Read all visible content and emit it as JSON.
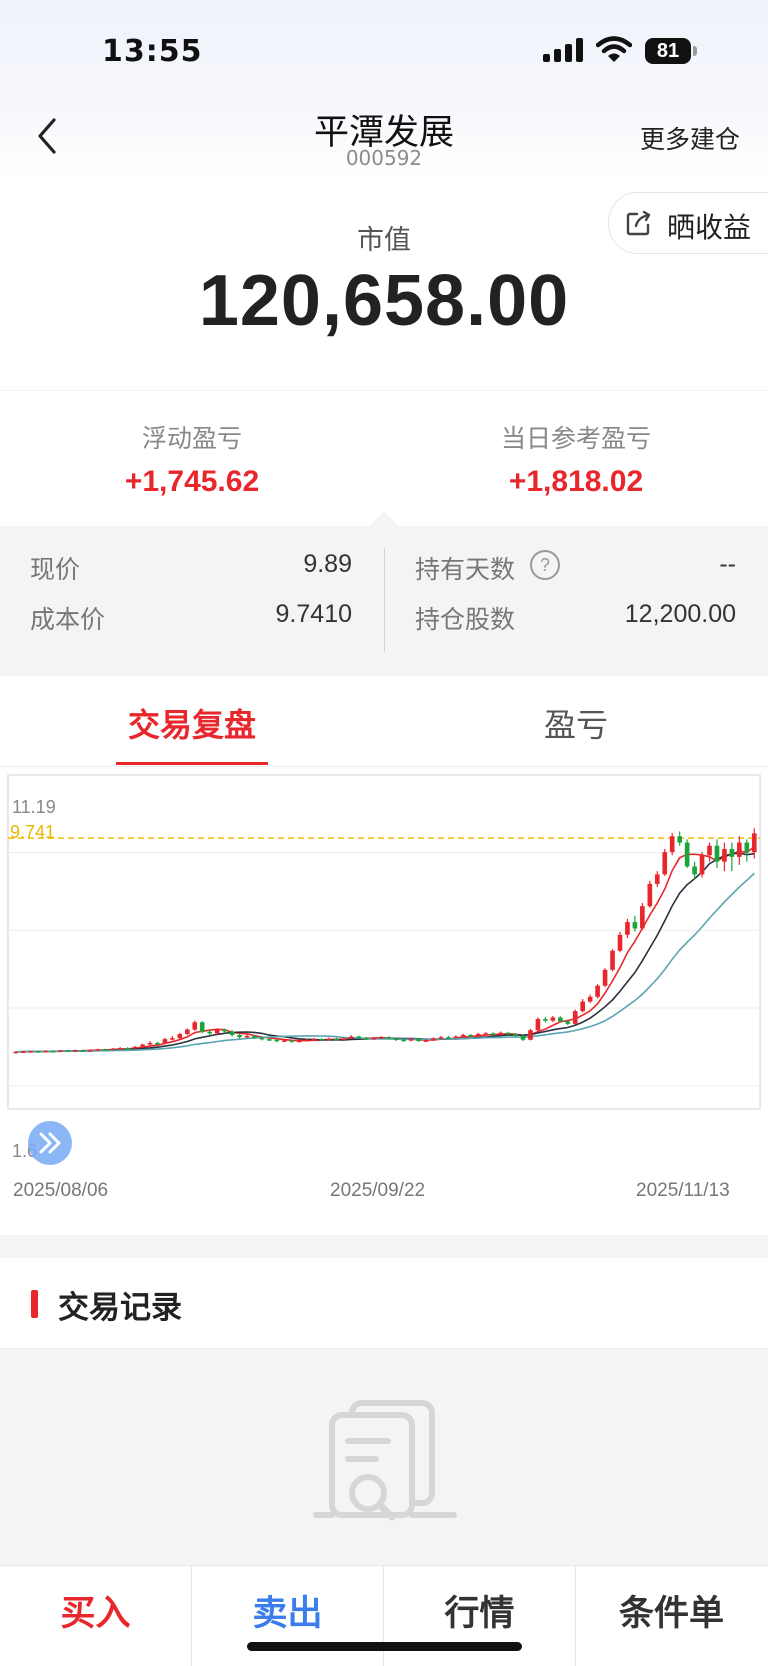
{
  "status_bar": {
    "time": "13:55",
    "battery": "81"
  },
  "nav": {
    "title": "平潭发展",
    "code": "000592",
    "more_label": "更多建仓"
  },
  "summary": {
    "share_label": "晒收益",
    "market_value_label": "市值",
    "market_value": "120,658.00"
  },
  "pnl": {
    "floating_label": "浮动盈亏",
    "floating_value": "+1,745.62",
    "daily_label": "当日参考盈亏",
    "daily_value": "+1,818.02"
  },
  "details": {
    "price_label": "现价",
    "price_value": "9.89",
    "cost_label": "成本价",
    "cost_value": "9.7410",
    "days_label": "持有天数",
    "days_value": "--",
    "shares_label": "持仓股数",
    "shares_value": "12,200.00",
    "help_glyph": "?"
  },
  "tabs": [
    {
      "label": "交易复盘",
      "active": true
    },
    {
      "label": "盈亏",
      "active": false
    }
  ],
  "chart": {
    "y_max_label": "11.19",
    "cost_label": "9.741",
    "y_min_label": "1.6",
    "x_labels": [
      "2025/08/06",
      "2025/09/22",
      "2025/11/13"
    ]
  },
  "chart_data": {
    "type": "candlestick",
    "ylim": [
      1.6,
      11.19
    ],
    "cost_line": 9.741,
    "x_ticks": [
      "2025/08/06",
      "2025/09/22",
      "2025/11/13"
    ],
    "up_color": "#e8272d",
    "down_color": "#1aa43a",
    "candles": [
      [
        3.0,
        3.02,
        3.04,
        2.98
      ],
      [
        3.02,
        3.03,
        3.05,
        3.0
      ],
      [
        3.03,
        3.04,
        3.06,
        3.01
      ],
      [
        3.04,
        3.03,
        3.06,
        3.01
      ],
      [
        3.03,
        3.05,
        3.07,
        3.02
      ],
      [
        3.05,
        3.04,
        3.07,
        3.02
      ],
      [
        3.04,
        3.06,
        3.08,
        3.03
      ],
      [
        3.06,
        3.05,
        3.08,
        3.03
      ],
      [
        3.05,
        3.07,
        3.09,
        3.04
      ],
      [
        3.07,
        3.06,
        3.09,
        3.04
      ],
      [
        3.06,
        3.08,
        3.1,
        3.05
      ],
      [
        3.08,
        3.1,
        3.12,
        3.06
      ],
      [
        3.1,
        3.09,
        3.12,
        3.07
      ],
      [
        3.09,
        3.12,
        3.14,
        3.08
      ],
      [
        3.12,
        3.14,
        3.17,
        3.1
      ],
      [
        3.14,
        3.13,
        3.16,
        3.11
      ],
      [
        3.13,
        3.18,
        3.2,
        3.12
      ],
      [
        3.18,
        3.25,
        3.28,
        3.15
      ],
      [
        3.25,
        3.3,
        3.36,
        3.22
      ],
      [
        3.3,
        3.28,
        3.34,
        3.24
      ],
      [
        3.28,
        3.42,
        3.46,
        3.26
      ],
      [
        3.42,
        3.45,
        3.52,
        3.38
      ],
      [
        3.45,
        3.58,
        3.62,
        3.42
      ],
      [
        3.58,
        3.72,
        3.76,
        3.54
      ],
      [
        3.72,
        3.95,
        4.0,
        3.68
      ],
      [
        3.95,
        3.65,
        3.98,
        3.6
      ],
      [
        3.65,
        3.6,
        3.7,
        3.55
      ],
      [
        3.6,
        3.72,
        3.76,
        3.56
      ],
      [
        3.72,
        3.66,
        3.75,
        3.6
      ],
      [
        3.66,
        3.55,
        3.7,
        3.5
      ],
      [
        3.55,
        3.48,
        3.58,
        3.44
      ],
      [
        3.48,
        3.52,
        3.56,
        3.45
      ],
      [
        3.52,
        3.46,
        3.55,
        3.42
      ],
      [
        3.46,
        3.42,
        3.5,
        3.38
      ],
      [
        3.42,
        3.4,
        3.46,
        3.36
      ],
      [
        3.4,
        3.36,
        3.44,
        3.32
      ],
      [
        3.36,
        3.38,
        3.42,
        3.33
      ],
      [
        3.38,
        3.35,
        3.41,
        3.31
      ],
      [
        3.35,
        3.37,
        3.4,
        3.32
      ],
      [
        3.37,
        3.4,
        3.44,
        3.34
      ],
      [
        3.4,
        3.42,
        3.46,
        3.37
      ],
      [
        3.42,
        3.4,
        3.45,
        3.37
      ],
      [
        3.4,
        3.43,
        3.47,
        3.38
      ],
      [
        3.43,
        3.41,
        3.46,
        3.38
      ],
      [
        3.41,
        3.44,
        3.48,
        3.39
      ],
      [
        3.44,
        3.5,
        3.54,
        3.42
      ],
      [
        3.5,
        3.46,
        3.53,
        3.43
      ],
      [
        3.46,
        3.42,
        3.49,
        3.39
      ],
      [
        3.42,
        3.45,
        3.49,
        3.4
      ],
      [
        3.45,
        3.48,
        3.52,
        3.43
      ],
      [
        3.48,
        3.44,
        3.51,
        3.41
      ],
      [
        3.44,
        3.4,
        3.47,
        3.36
      ],
      [
        3.4,
        3.38,
        3.43,
        3.34
      ],
      [
        3.38,
        3.42,
        3.46,
        3.35
      ],
      [
        3.42,
        3.36,
        3.45,
        3.33
      ],
      [
        3.36,
        3.38,
        3.42,
        3.33
      ],
      [
        3.38,
        3.44,
        3.48,
        3.36
      ],
      [
        3.44,
        3.48,
        3.52,
        3.41
      ],
      [
        3.48,
        3.46,
        3.52,
        3.43
      ],
      [
        3.46,
        3.5,
        3.54,
        3.44
      ],
      [
        3.5,
        3.55,
        3.59,
        3.47
      ],
      [
        3.55,
        3.52,
        3.58,
        3.49
      ],
      [
        3.52,
        3.58,
        3.62,
        3.5
      ],
      [
        3.58,
        3.6,
        3.64,
        3.55
      ],
      [
        3.6,
        3.56,
        3.63,
        3.53
      ],
      [
        3.56,
        3.62,
        3.66,
        3.54
      ],
      [
        3.62,
        3.58,
        3.65,
        3.55
      ],
      [
        3.58,
        3.52,
        3.61,
        3.49
      ],
      [
        3.52,
        3.4,
        3.55,
        3.36
      ],
      [
        3.4,
        3.7,
        3.74,
        3.38
      ],
      [
        3.7,
        4.05,
        4.1,
        3.66
      ],
      [
        4.05,
        4.0,
        4.12,
        3.95
      ],
      [
        4.0,
        4.1,
        4.15,
        3.96
      ],
      [
        4.1,
        3.98,
        4.14,
        3.94
      ],
      [
        3.98,
        3.9,
        4.02,
        3.86
      ],
      [
        3.9,
        4.3,
        4.35,
        3.88
      ],
      [
        4.3,
        4.6,
        4.68,
        4.26
      ],
      [
        4.6,
        4.75,
        4.82,
        4.55
      ],
      [
        4.75,
        5.1,
        5.15,
        4.7
      ],
      [
        5.1,
        5.6,
        5.65,
        5.05
      ],
      [
        5.6,
        6.2,
        6.25,
        5.55
      ],
      [
        6.2,
        6.7,
        6.8,
        6.15
      ],
      [
        6.7,
        7.1,
        7.2,
        6.6
      ],
      [
        7.1,
        6.9,
        7.3,
        6.8
      ],
      [
        6.9,
        7.6,
        7.7,
        6.85
      ],
      [
        7.6,
        8.3,
        8.4,
        7.55
      ],
      [
        8.3,
        8.6,
        8.7,
        8.2
      ],
      [
        8.6,
        9.3,
        9.4,
        8.55
      ],
      [
        9.3,
        9.8,
        9.9,
        9.2
      ],
      [
        9.8,
        9.6,
        9.95,
        9.5
      ],
      [
        9.6,
        8.85,
        9.7,
        8.8
      ],
      [
        8.85,
        8.6,
        9.0,
        8.45
      ],
      [
        8.6,
        9.2,
        9.3,
        8.5
      ],
      [
        9.2,
        9.5,
        9.6,
        9.0
      ],
      [
        9.5,
        9.0,
        9.7,
        8.8
      ],
      [
        9.0,
        9.4,
        9.6,
        8.7
      ],
      [
        9.4,
        9.15,
        9.6,
        8.7
      ],
      [
        9.15,
        9.6,
        9.8,
        8.9
      ],
      [
        9.6,
        9.3,
        9.7,
        9.0
      ],
      [
        9.3,
        9.89,
        10.05,
        9.1
      ]
    ],
    "ma_colors": [
      "#e8272d",
      "#2a3140",
      "#5aa5b0"
    ]
  },
  "records": {
    "title": "交易记录"
  },
  "bottom_bar": {
    "buy": "买入",
    "sell": "卖出",
    "quote": "行情",
    "conditional": "条件单"
  }
}
